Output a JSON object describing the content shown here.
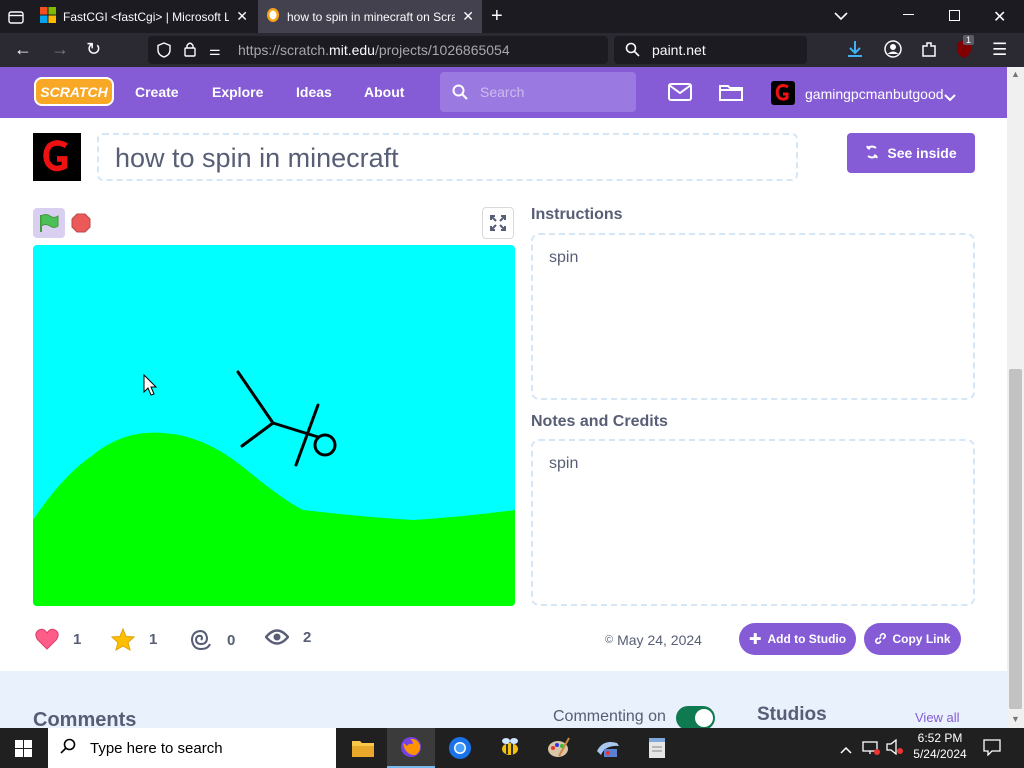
{
  "browser": {
    "tabs": [
      {
        "title": "FastCGI <fastCgi> | Microsoft Le"
      },
      {
        "title": "how to spin in minecraft on Scra"
      }
    ],
    "url_prefix": "https://scratch.",
    "url_host": "mit.edu",
    "url_path": "/projects/1026865054",
    "search_text": "paint.net",
    "download_badge": "1"
  },
  "scratch_nav": {
    "logo": "SCRATCH",
    "links": [
      "Create",
      "Explore",
      "Ideas",
      "About"
    ],
    "search_placeholder": "Search",
    "username": "gamingpcmanbutgood",
    "accent": "#855cd6"
  },
  "project": {
    "title": "how to spin in minecraft",
    "see_inside": "See inside",
    "instructions_title": "Instructions",
    "instructions": "spin",
    "notes_title": "Notes and Credits",
    "notes": "spin",
    "loves": "1",
    "favorites": "1",
    "remixes": "0",
    "views": "2",
    "date": "May 24, 2024",
    "add_to_studio": "Add to Studio",
    "copy_link": "Copy Link"
  },
  "lower": {
    "comments_title": "Comments",
    "commenting_label": "Commenting on",
    "studios_title": "Studios",
    "view_all": "View all"
  },
  "taskbar": {
    "search_placeholder": "Type here to search",
    "time": "6:52 PM",
    "date": "5/24/2024"
  }
}
